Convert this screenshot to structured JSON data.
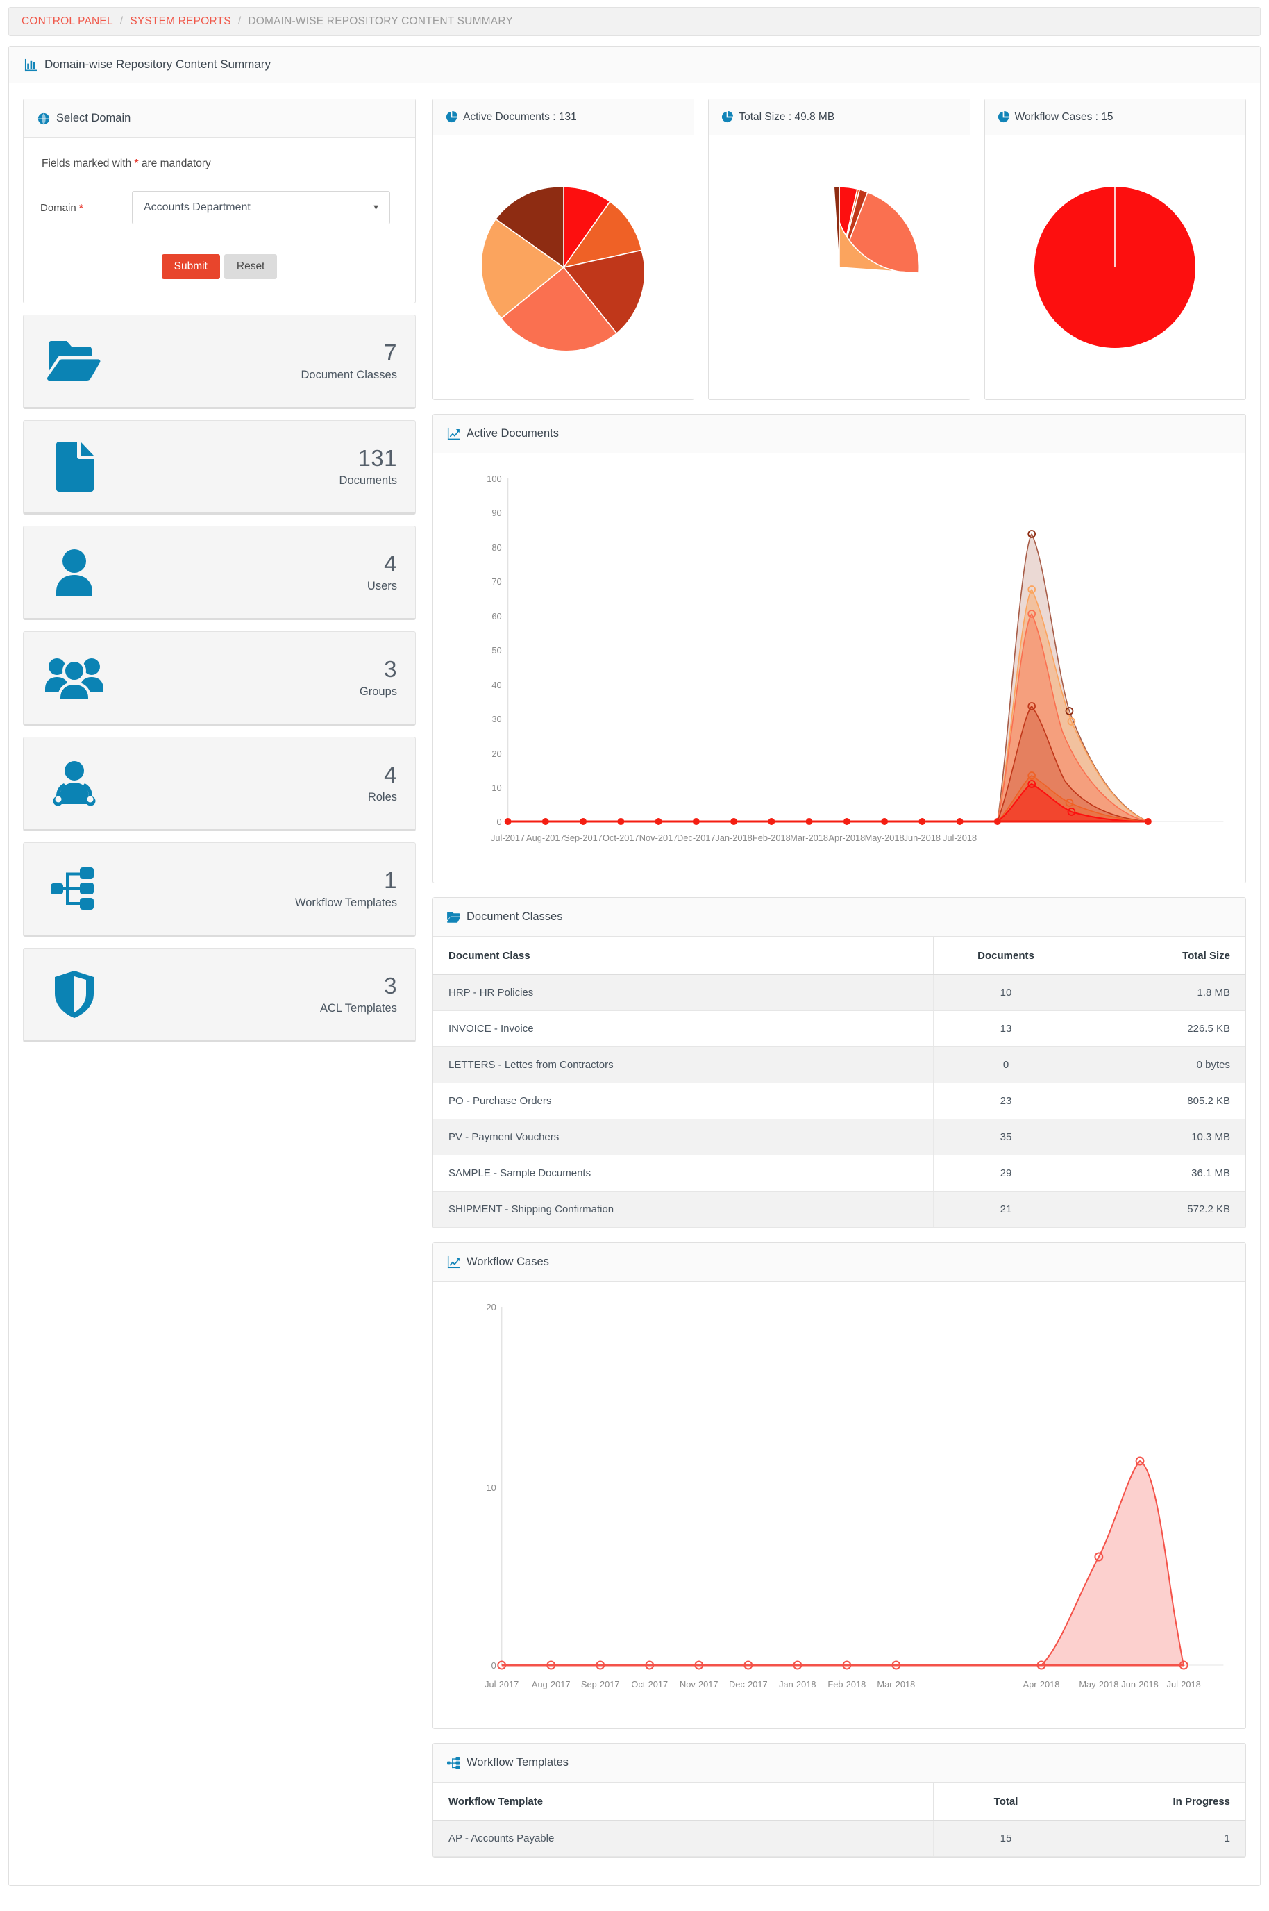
{
  "breadcrumb": {
    "items": [
      "CONTROL PANEL",
      "SYSTEM REPORTS",
      "DOMAIN-WISE REPOSITORY CONTENT SUMMARY"
    ],
    "separator": "/"
  },
  "page": {
    "title": "Domain-wise Repository Content Summary"
  },
  "select_domain": {
    "title": "Select Domain",
    "mandatory_note_prefix": "Fields marked with ",
    "mandatory_note_star": "*",
    "mandatory_note_suffix": " are mandatory",
    "domain_label": "Domain",
    "domain_required_star": "*",
    "domain_value": "Accounts Department",
    "submit_label": "Submit",
    "reset_label": "Reset"
  },
  "stats": [
    {
      "value": "7",
      "label": "Document Classes",
      "icon": "folder-open-icon"
    },
    {
      "value": "131",
      "label": "Documents",
      "icon": "document-icon"
    },
    {
      "value": "4",
      "label": "Users",
      "icon": "user-icon"
    },
    {
      "value": "3",
      "label": "Groups",
      "icon": "group-icon"
    },
    {
      "value": "4",
      "label": "Roles",
      "icon": "role-icon"
    },
    {
      "value": "1",
      "label": "Workflow Templates",
      "icon": "workflow-icon"
    },
    {
      "value": "3",
      "label": "ACL Templates",
      "icon": "shield-icon"
    }
  ],
  "pies": [
    {
      "title": "Active Documents : 131"
    },
    {
      "title": "Total Size : 49.8 MB"
    },
    {
      "title": "Workflow Cases : 15"
    }
  ],
  "active_documents_panel": {
    "title": "Active Documents"
  },
  "workflow_cases_panel": {
    "title": "Workflow Cases"
  },
  "document_classes": {
    "title": "Document Classes",
    "columns": [
      "Document Class",
      "Documents",
      "Total Size"
    ],
    "rows": [
      [
        "HRP - HR Policies",
        "10",
        "1.8 MB"
      ],
      [
        "INVOICE - Invoice",
        "13",
        "226.5 KB"
      ],
      [
        "LETTERS - Lettes from Contractors",
        "0",
        "0 bytes"
      ],
      [
        "PO - Purchase Orders",
        "23",
        "805.2 KB"
      ],
      [
        "PV - Payment Vouchers",
        "35",
        "10.3 MB"
      ],
      [
        "SAMPLE - Sample Documents",
        "29",
        "36.1 MB"
      ],
      [
        "SHIPMENT - Shipping Confirmation",
        "21",
        "572.2 KB"
      ]
    ]
  },
  "workflow_templates": {
    "title": "Workflow Templates",
    "columns": [
      "Workflow Template",
      "Total",
      "In Progress"
    ],
    "rows": [
      [
        "AP - Accounts Payable",
        "15",
        "1"
      ]
    ]
  },
  "colors": {
    "accent_red": "#e8452c",
    "breadcrumb_link": "#f0584a",
    "icon_blue": "#0b83b4",
    "pie_palette": [
      "#fd0f0f",
      "#ef6126",
      "#c0371a",
      "#fa7050",
      "#fba45e",
      "#8e2c12",
      "#f2683f"
    ]
  },
  "chart_data": [
    {
      "type": "pie",
      "title": "Active Documents : 131",
      "labels": [
        "HRP - HR Policies",
        "INVOICE - Invoice",
        "PO - Purchase Orders",
        "PV - Payment Vouchers",
        "SAMPLE - Sample Documents",
        "SHIPMENT - Shipping Confirmation"
      ],
      "values": [
        10,
        13,
        23,
        35,
        29,
        21
      ],
      "colors": [
        "#fd0f0f",
        "#ef6126",
        "#c0371a",
        "#fa7050",
        "#fba45e",
        "#8e2c12"
      ],
      "legend": "none"
    },
    {
      "type": "pie",
      "title": "Total Size : 49.8 MB",
      "labels": [
        "HRP - HR Policies",
        "INVOICE - Invoice",
        "LETTERS - Lettes from Contractors",
        "PO - Purchase Orders",
        "PV - Payment Vouchers",
        "SAMPLE - Sample Documents",
        "SHIPMENT - Shipping Confirmation"
      ],
      "values": [
        1.8,
        0.226,
        0.0,
        0.805,
        10.3,
        36.1,
        0.572
      ],
      "unit": "MB",
      "colors": [
        "#fd0f0f",
        "#ef6126",
        "#c0371a",
        "#c0371a",
        "#fa7050",
        "#fba45e",
        "#8e2c12"
      ],
      "legend": "none"
    },
    {
      "type": "pie",
      "title": "Workflow Cases : 15",
      "labels": [
        "AP - Accounts Payable"
      ],
      "values": [
        15
      ],
      "colors": [
        "#fd0f0f"
      ],
      "legend": "none"
    },
    {
      "type": "area",
      "title": "Active Documents",
      "xlabel": "",
      "ylabel": "",
      "x": [
        "Jul-2017",
        "Aug-2017",
        "Sep-2017",
        "Oct-2017",
        "Nov-2017",
        "Dec-2017",
        "Jan-2018",
        "Feb-2018",
        "Mar-2018",
        "Apr-2018",
        "May-2018",
        "Jun-2018",
        "Jul-2018"
      ],
      "ylim": [
        0,
        100
      ],
      "yticks": [
        0,
        10,
        20,
        30,
        40,
        50,
        60,
        70,
        80,
        90,
        100
      ],
      "grid": false,
      "series": [
        {
          "name": "SAMPLE - Sample Documents",
          "color": "#8e2c12",
          "values": [
            0,
            0,
            0,
            0,
            0,
            0,
            0,
            0,
            0,
            0,
            97,
            33,
            0
          ]
        },
        {
          "name": "PV - Payment Vouchers",
          "color": "#fba45e",
          "values": [
            0,
            0,
            0,
            0,
            0,
            0,
            0,
            0,
            0,
            0,
            78,
            33,
            0
          ]
        },
        {
          "name": "PO - Purchase Orders",
          "color": "#fa7050",
          "values": [
            0,
            0,
            0,
            0,
            0,
            0,
            0,
            0,
            0,
            0,
            70,
            10,
            0
          ]
        },
        {
          "name": "INVOICE - Invoice",
          "color": "#c0371a",
          "values": [
            0,
            0,
            0,
            0,
            0,
            0,
            0,
            0,
            0,
            0,
            35,
            10,
            0
          ]
        },
        {
          "name": "SHIPMENT - Shipping Confirmation",
          "color": "#ef6126",
          "values": [
            0,
            0,
            0,
            0,
            0,
            0,
            0,
            0,
            0,
            0,
            13,
            0,
            0
          ]
        },
        {
          "name": "HRP - HR Policies",
          "color": "#fd0f0f",
          "values": [
            0,
            0,
            0,
            0,
            0,
            0,
            0,
            0,
            0,
            0,
            10,
            0,
            0
          ]
        }
      ]
    },
    {
      "type": "area",
      "title": "Workflow Cases",
      "xlabel": "",
      "ylabel": "",
      "x": [
        "Jul-2017",
        "Aug-2017",
        "Sep-2017",
        "Oct-2017",
        "Nov-2017",
        "Dec-2017",
        "Jan-2018",
        "Feb-2018",
        "Mar-2018",
        "Apr-2018",
        "May-2018",
        "Jun-2018",
        "Jul-2018"
      ],
      "ylim": [
        0,
        20
      ],
      "yticks": [
        0,
        10,
        20
      ],
      "grid": false,
      "series": [
        {
          "name": "AP - Accounts Payable",
          "color": "#f4534a",
          "values": [
            0,
            0,
            0,
            0,
            0,
            0,
            0,
            0,
            0,
            0,
            4,
            11.5,
            0
          ]
        }
      ]
    }
  ]
}
